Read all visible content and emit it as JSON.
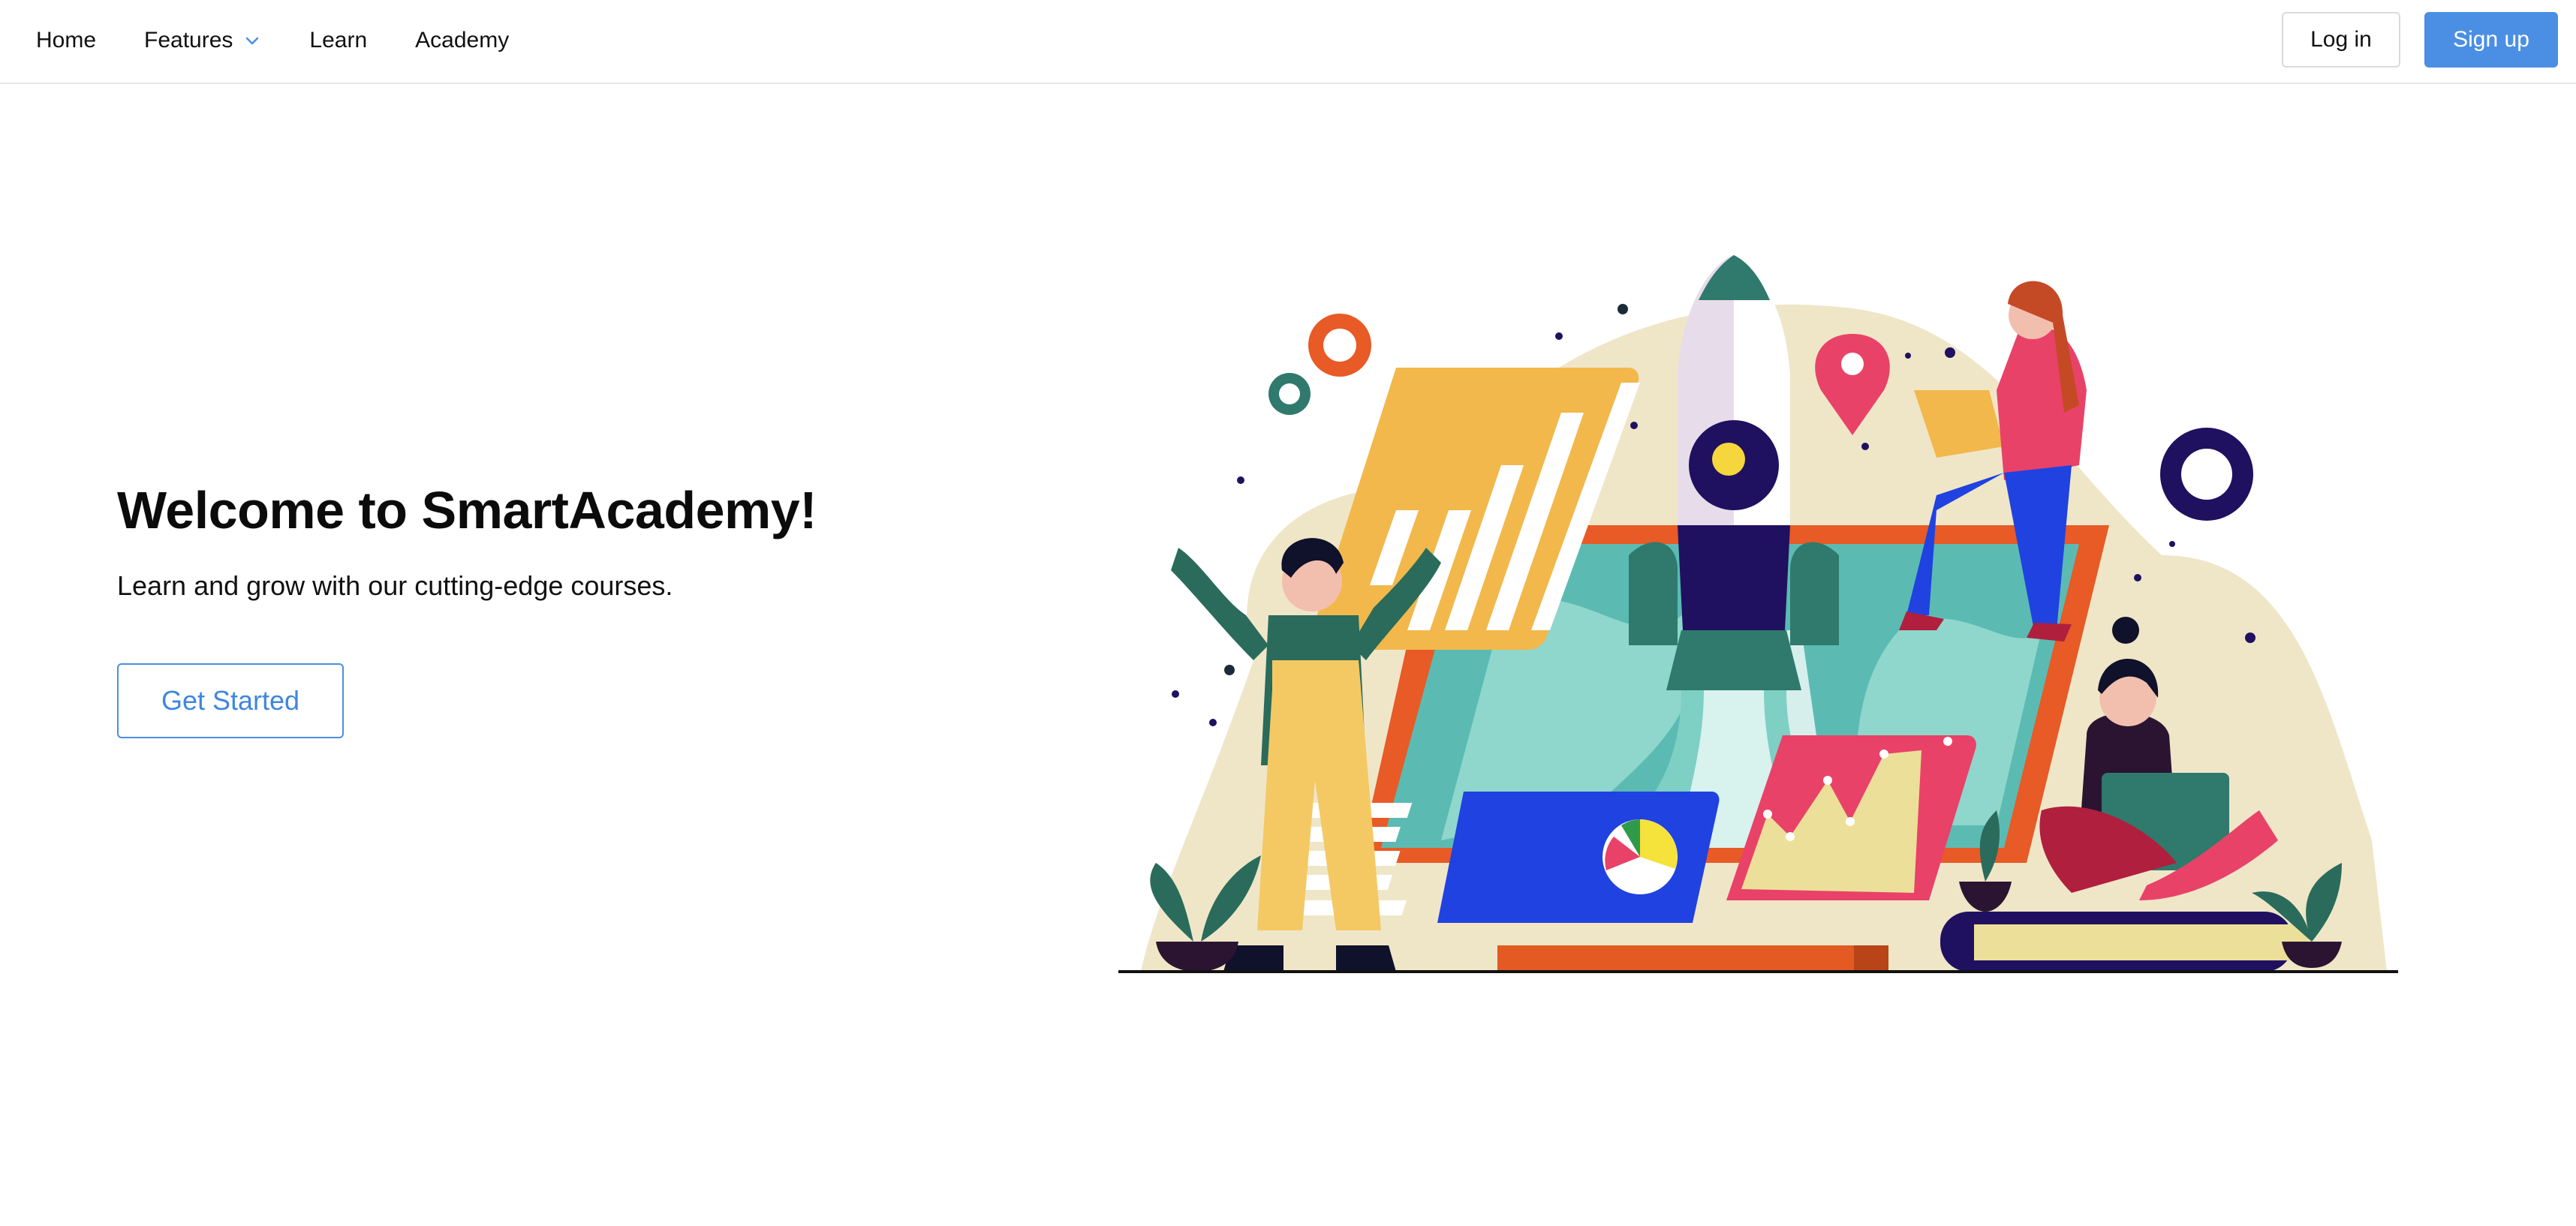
{
  "nav": {
    "items": [
      {
        "label": "Home"
      },
      {
        "label": "Features",
        "has_dropdown": true,
        "icon": "chevron-down-icon"
      },
      {
        "label": "Learn"
      },
      {
        "label": "Academy"
      }
    ]
  },
  "auth": {
    "login_label": "Log in",
    "signup_label": "Sign up"
  },
  "hero": {
    "title": "Welcome to SmartAcademy!",
    "subtitle": "Learn and grow with our cutting-edge courses.",
    "cta_label": "Get Started"
  },
  "colors": {
    "accent": "#4a8fe3",
    "border": "#d7dbe0"
  },
  "illustration": {
    "icon": "startup-rocket-illustration"
  }
}
